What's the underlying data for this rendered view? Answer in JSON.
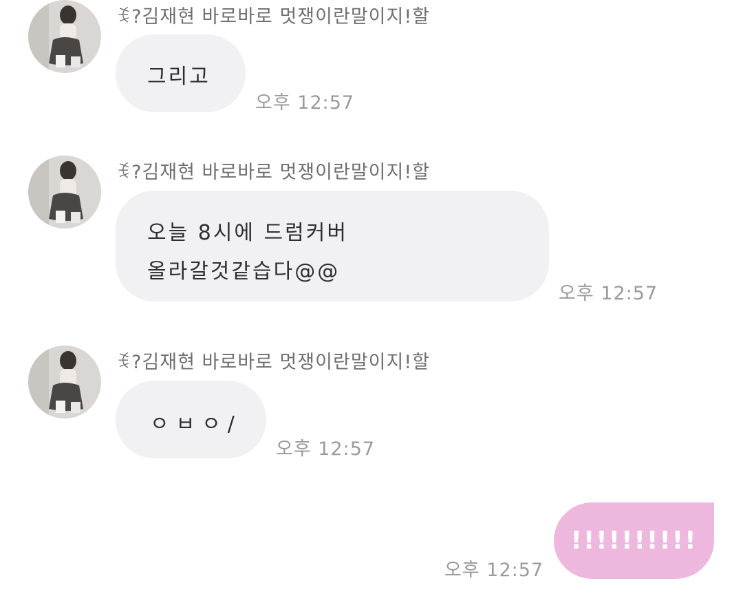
{
  "sender_name": "ꉂ?김재현 바로바로 멋쟁이란말이지!할",
  "messages": [
    {
      "text": "그리고",
      "time": "오후 12:57"
    },
    {
      "text": "오늘 8시에 드럼커버\n올라갈것같습다@@",
      "time": "오후 12:57"
    },
    {
      "text": "ㅇㅂㅇ/",
      "time": "오후 12:57"
    }
  ],
  "my_message": {
    "text": "!!!!!!!!!!",
    "time": "오후 12:57"
  },
  "colors": {
    "incoming_bubble": "#f1f1f4",
    "outgoing_bubble": "#eeb8de",
    "timestamp": "#9a9a9a"
  }
}
